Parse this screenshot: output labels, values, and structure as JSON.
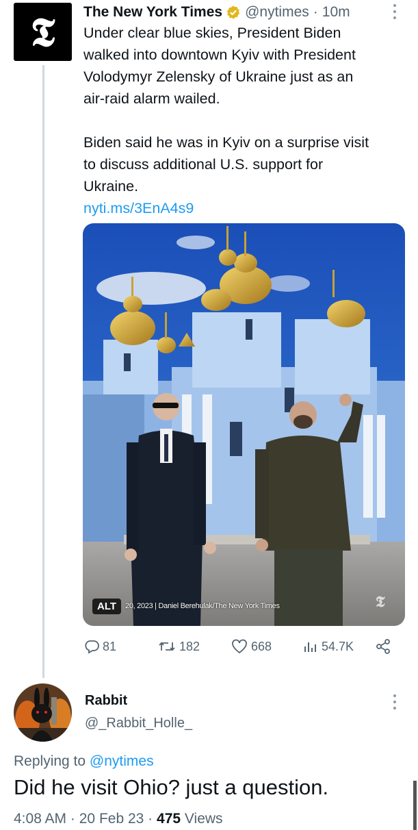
{
  "tweet": {
    "author_name": "The New York Times",
    "logo_glyph": "𝕿",
    "handle": "@nytimes",
    "separator": "·",
    "time_ago": "10m",
    "text_lines": [
      "Under clear blue skies, President Biden",
      "walked into downtown Kyiv with President",
      "Volodymyr Zelensky of Ukraine just as an",
      "air-raid alarm wailed.",
      "Biden said he was in Kyiv on a surprise visit",
      "to discuss additional U.S. support for",
      "Ukraine."
    ],
    "link": "nyti.ms/3EnA4s9",
    "media": {
      "alt_badge": "ALT",
      "caption": "20, 2023 | Daniel Berehulak/The New York Times",
      "watermark": "𝕿"
    },
    "stats": {
      "replies": "81",
      "retweets": "182",
      "likes": "668",
      "views": "54.7K"
    },
    "icons": [
      "verified-badge-icon",
      "more-icon",
      "reply-icon",
      "retweet-icon",
      "like-icon",
      "views-icon",
      "share-icon"
    ]
  },
  "reply": {
    "author_name": "Rabbit",
    "handle": "@_Rabbit_Holle_",
    "replying_prefix": "Replying to",
    "replying_handle": "@nytimes",
    "text": "Did he visit Ohio? just a question.",
    "time": "4:08 AM",
    "sep1": "·",
    "date": "20 Feb 23",
    "sep2": "·",
    "views_count": "475",
    "views_label": "Views"
  },
  "colors": {
    "accent": "#1d9bf0",
    "secondary_text": "#536471",
    "verified_gold": "#e2b719"
  }
}
